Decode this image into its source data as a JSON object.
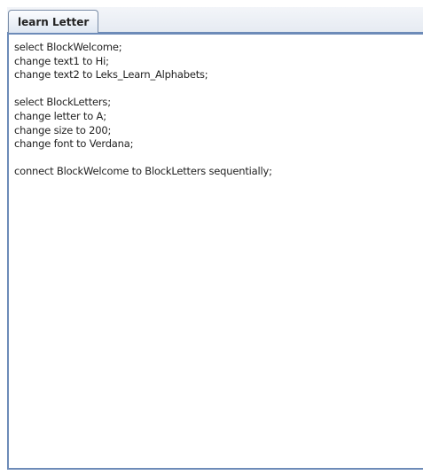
{
  "tabs": [
    {
      "label": "learn Letter",
      "selected": true
    }
  ],
  "editor": {
    "lines": [
      "select BlockWelcome;",
      "change text1 to Hi;",
      "change text2 to Leks_Learn_Alphabets;",
      "",
      "select BlockLetters;",
      "change letter to A;",
      "change size to 200;",
      "change font to Verdana;",
      "",
      "connect BlockWelcome to BlockLetters sequentially;"
    ]
  },
  "colors": {
    "accent_border": "#6d8bb8",
    "tab_background": "#dfe7f2",
    "text": "#222222"
  }
}
